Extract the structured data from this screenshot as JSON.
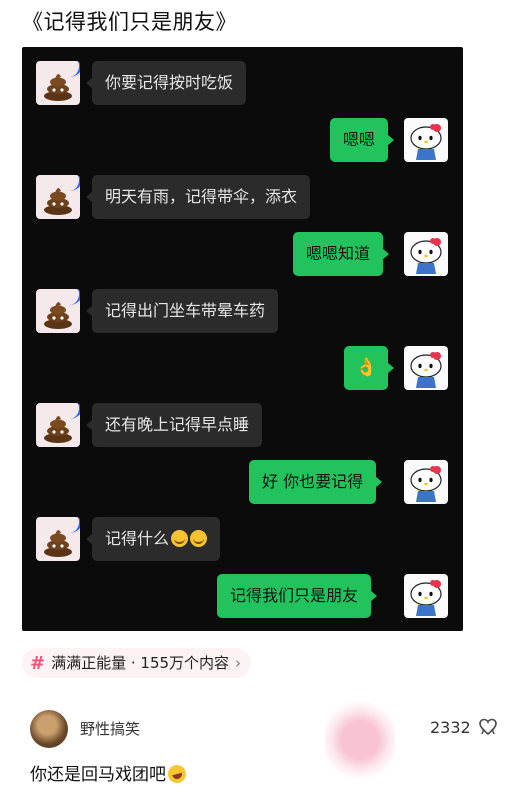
{
  "title": "《记得我们只是朋友》",
  "messages": [
    {
      "side": "left",
      "text": "你要记得按时吃饭"
    },
    {
      "side": "right",
      "text": "嗯嗯"
    },
    {
      "side": "left",
      "text": "明天有雨，记得带伞，添衣"
    },
    {
      "side": "right",
      "text": "嗯嗯知道"
    },
    {
      "side": "left",
      "text": "记得出门坐车带晕车药"
    },
    {
      "side": "right",
      "text": "",
      "icon": "ok-hand-icon"
    },
    {
      "side": "left",
      "text": "还有晚上记得早点睡"
    },
    {
      "side": "right",
      "text": "好 你也要记得"
    },
    {
      "side": "left",
      "text": "记得什么",
      "emoji": "smiling-face-icon"
    },
    {
      "side": "right",
      "text": "记得我们只是朋友"
    }
  ],
  "topic": {
    "hash": "#",
    "label": "满满正能量 · 155万个内容",
    "chevron": "›"
  },
  "comment": {
    "username": "野性搞笑",
    "likes": "2332",
    "text": "你还是回马戏团吧"
  },
  "colors": {
    "chat_bg": "#0b0b0b",
    "left_bubble": "#2b2b2b",
    "right_bubble": "#22c35d",
    "topic_accent": "#f4527a"
  }
}
